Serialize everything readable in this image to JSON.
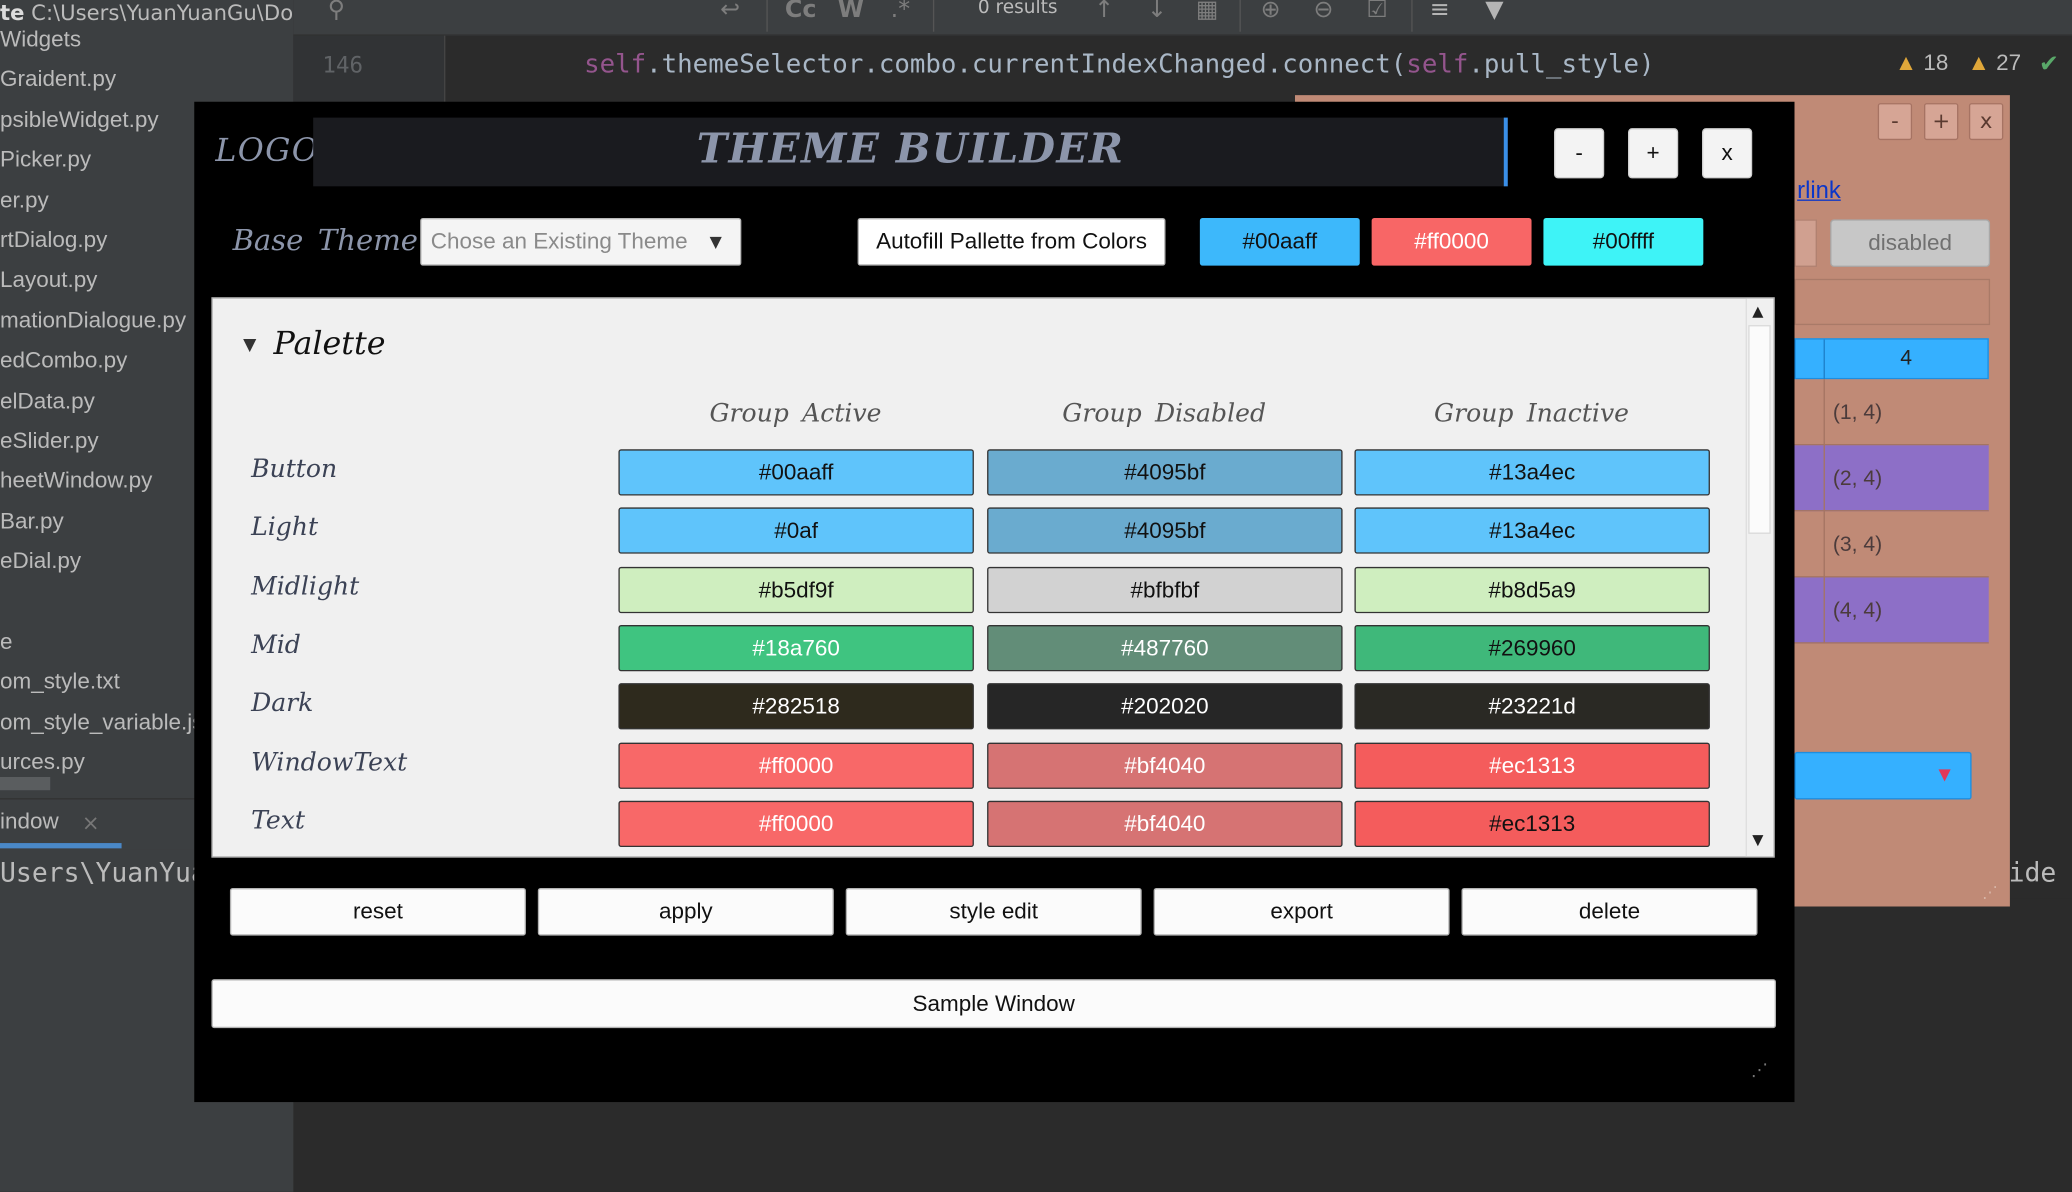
{
  "ide": {
    "project_header_title": "te",
    "project_header_path": "C:\\Users\\YuanYuanGu\\Do",
    "project_files": [
      "Widgets",
      "Graident.py",
      "psibleWidget.py",
      "Picker.py",
      "er.py",
      "rtDialog.py",
      "Layout.py",
      "mationDialogue.py",
      "edCombo.py",
      "elData.py",
      "eSlider.py",
      "heetWindow.py",
      "Bar.py",
      "eDial.py",
      "",
      "e",
      "om_style.txt",
      "om_style_variable.js",
      "urces.py"
    ],
    "run_tab_label": "indow",
    "run_tab_close": "×",
    "run_output_path": "Users\\YuanYua",
    "run_output_right": "ide",
    "search_results": "0 results",
    "line_number": "146",
    "code": {
      "self1": "self",
      "part1": ".themeSelector.combo.currentIndexChanged.connect(",
      "self2": "self",
      "part2": ".pull_style)"
    },
    "warnings_count": "18",
    "weak_warnings_count": "27"
  },
  "sample_window": {
    "controls": [
      "-",
      "+",
      "x"
    ],
    "link_text": "rlink",
    "disabled_button": "disabled",
    "table_header": "4",
    "table_cells": [
      "(1, 4)",
      "(2, 4)",
      "(3, 4)",
      "(4, 4)"
    ],
    "row_colors": [
      "#c08a76",
      "#8d6fc7",
      "#c08a76",
      "#8d6fc7"
    ]
  },
  "theme_builder": {
    "logo": "LOGO",
    "title": "THEME BUILDER",
    "window_controls": [
      "-",
      "+",
      "x"
    ],
    "base_theme_label": "Base Theme",
    "theme_combo_placeholder": "Chose an Existing Theme",
    "autofill_button": "Autofill Pallette from Colors",
    "color_buttons": [
      {
        "label": "#00aaff",
        "bg": "#3db8fb",
        "fg": "#111111"
      },
      {
        "label": "#ff0000",
        "bg": "#f86666",
        "fg": "#ffffff"
      },
      {
        "label": "#00ffff",
        "bg": "#3ef3f7",
        "fg": "#111111"
      }
    ],
    "palette": {
      "title": "Palette",
      "groups": [
        "Group Active",
        "Group Disabled",
        "Group Inactive"
      ],
      "rows": [
        {
          "label": "Button",
          "cells": [
            {
              "text": "#00aaff",
              "bg": "#5fc4fb",
              "fg": "#111111"
            },
            {
              "text": "#4095bf",
              "bg": "#6aabcf",
              "fg": "#111111"
            },
            {
              "text": "#13a4ec",
              "bg": "#5fc4fb",
              "fg": "#111111"
            }
          ]
        },
        {
          "label": "Light",
          "cells": [
            {
              "text": "#0af",
              "bg": "#5fc4fb",
              "fg": "#111111"
            },
            {
              "text": "#4095bf",
              "bg": "#6aabcf",
              "fg": "#111111"
            },
            {
              "text": "#13a4ec",
              "bg": "#5fc4fb",
              "fg": "#111111"
            }
          ]
        },
        {
          "label": "Midlight",
          "cells": [
            {
              "text": "#b5df9f",
              "bg": "#cfeebf",
              "fg": "#111111"
            },
            {
              "text": "#bfbfbf",
              "bg": "#d2d2d2",
              "fg": "#111111"
            },
            {
              "text": "#b8d5a9",
              "bg": "#cfeebf",
              "fg": "#111111"
            }
          ]
        },
        {
          "label": "Mid",
          "cells": [
            {
              "text": "#18a760",
              "bg": "#3fc480",
              "fg": "#ffffff"
            },
            {
              "text": "#487760",
              "bg": "#628d78",
              "fg": "#ffffff"
            },
            {
              "text": "#269960",
              "bg": "#3fb87a",
              "fg": "#111111"
            }
          ]
        },
        {
          "label": "Dark",
          "cells": [
            {
              "text": "#282518",
              "bg": "#2e2a1d",
              "fg": "#ffffff"
            },
            {
              "text": "#202020",
              "bg": "#262626",
              "fg": "#ffffff"
            },
            {
              "text": "#23221d",
              "bg": "#2a2924",
              "fg": "#ffffff"
            }
          ]
        },
        {
          "label": "WindowText",
          "cells": [
            {
              "text": "#ff0000",
              "bg": "#f86868",
              "fg": "#ffffff"
            },
            {
              "text": "#bf4040",
              "bg": "#d67373",
              "fg": "#ffffff"
            },
            {
              "text": "#ec1313",
              "bg": "#f45c5c",
              "fg": "#ffffff"
            }
          ]
        },
        {
          "label": "Text",
          "cells": [
            {
              "text": "#ff0000",
              "bg": "#f86868",
              "fg": "#ffffff"
            },
            {
              "text": "#bf4040",
              "bg": "#d67373",
              "fg": "#ffffff"
            },
            {
              "text": "#ec1313",
              "bg": "#f45c5c",
              "fg": "#111111"
            }
          ]
        }
      ]
    },
    "actions": [
      "reset",
      "apply",
      "style edit",
      "export",
      "delete"
    ],
    "sample_window_button": "Sample Window"
  }
}
